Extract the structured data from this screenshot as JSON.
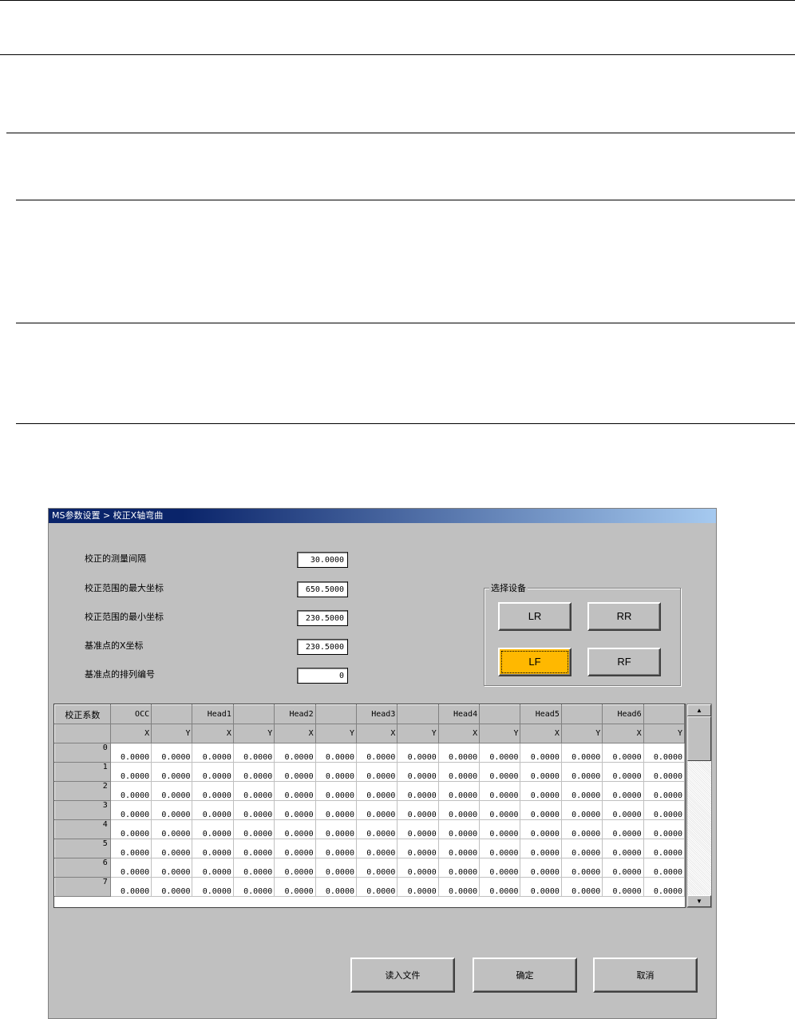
{
  "window": {
    "title": "MS参数设置 > 校正X轴弯曲"
  },
  "params": [
    {
      "label": "校正的测量间隔",
      "value": "30.0000"
    },
    {
      "label": "校正范围的最大坐标",
      "value": "650.5000"
    },
    {
      "label": "校正范围的最小坐标",
      "value": "230.5000"
    },
    {
      "label": "基准点的X坐标",
      "value": "230.5000"
    },
    {
      "label": "基准点的排列编号",
      "value": "0"
    }
  ],
  "device_group": {
    "title": "选择设备",
    "buttons": [
      "LR",
      "RR",
      "LF",
      "RF"
    ],
    "selected": "LF",
    "active_color": "#ffb800"
  },
  "grid": {
    "corner_label": "校正系数",
    "header_row1": [
      "OCC",
      "",
      "Head1",
      "",
      "Head2",
      "",
      "Head3",
      "",
      "Head4",
      "",
      "Head5",
      "",
      "Head6",
      ""
    ],
    "header_row2": [
      "X",
      "Y",
      "X",
      "Y",
      "X",
      "Y",
      "X",
      "Y",
      "X",
      "Y",
      "X",
      "Y",
      "X",
      "Y"
    ],
    "row_labels": [
      "0",
      "1",
      "2",
      "3",
      "4",
      "5",
      "6",
      "7"
    ],
    "cell_value": "0.0000"
  },
  "actions": {
    "read_file": "读入文件",
    "confirm": "确定",
    "cancel": "取消"
  }
}
